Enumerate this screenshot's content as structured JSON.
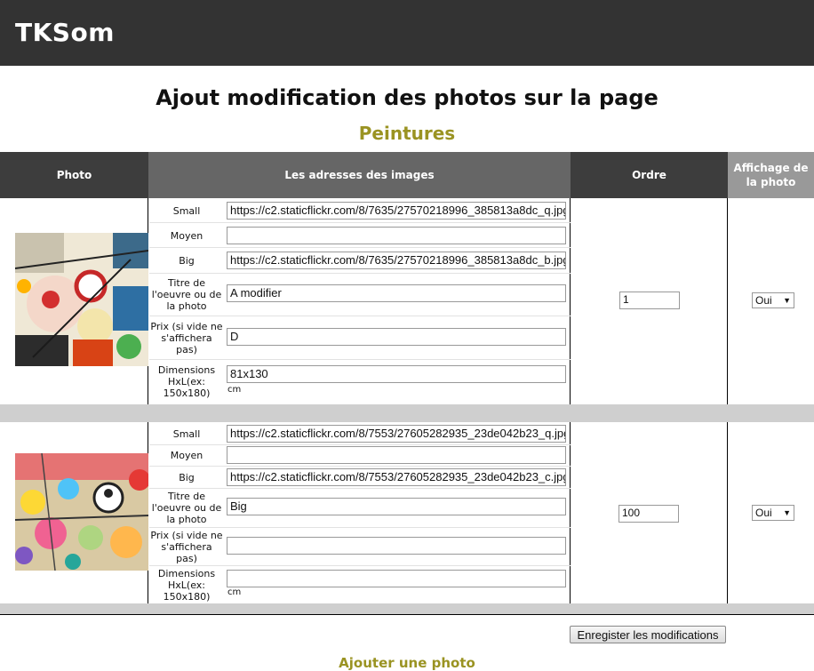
{
  "header": {
    "brand": "TKSom"
  },
  "page_title": "Ajout modification des photos sur la page",
  "section_title": "Peintures",
  "table": {
    "headers": {
      "photo": "Photo",
      "addresses": "Les adresses des images",
      "order": "Ordre",
      "display": "Affichage de la photo"
    },
    "field_labels": {
      "small": "Small",
      "medium": "Moyen",
      "big": "Big",
      "title": "Titre de l'oeuvre ou de la photo",
      "price": "Prix (si vide ne s'affichera pas)",
      "dimensions": "Dimensions HxL(ex: 150x180)",
      "unit": "cm"
    },
    "rows": [
      {
        "small": "https://c2.staticflickr.com/8/7635/27570218996_385813a8dc_q.jpg",
        "medium": "",
        "big": "https://c2.staticflickr.com/8/7635/27570218996_385813a8dc_b.jpg",
        "title": "A modifier",
        "price": "D",
        "dimensions": "81x130",
        "order": "1",
        "display": "Oui"
      },
      {
        "small": "https://c2.staticflickr.com/8/7553/27605282935_23de042b23_q.jpg",
        "medium": "",
        "big": "https://c2.staticflickr.com/8/7553/27605282935_23de042b23_c.jpg",
        "title": "Big",
        "price": "",
        "dimensions": "",
        "order": "100",
        "display": "Oui"
      }
    ]
  },
  "actions": {
    "save_label": "Enregister les modifications",
    "add_label": "Ajouter une photo"
  },
  "colors": {
    "topbar": "#333333",
    "accent": "#9a9322",
    "header_dark": "#3d3d3d",
    "header_mid": "#666666",
    "header_light": "#999999"
  }
}
